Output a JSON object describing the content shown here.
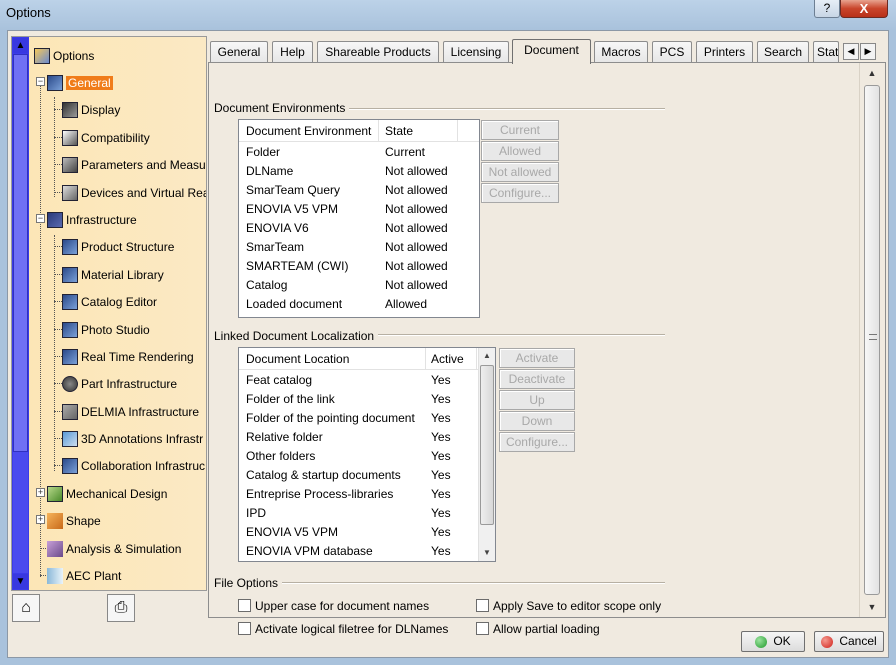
{
  "window": {
    "title": "Options",
    "help_label": "?",
    "close_label": "X"
  },
  "tree": {
    "items": [
      {
        "label": "Options",
        "icon": "options-tree-icon"
      },
      {
        "label": "General",
        "icon": "general-icon",
        "selected": true
      },
      {
        "label": "Display",
        "icon": "display-icon"
      },
      {
        "label": "Compatibility",
        "icon": "compatibility-icon"
      },
      {
        "label": "Parameters and Measure",
        "icon": "parameters-icon"
      },
      {
        "label": "Devices and Virtual Real",
        "icon": "devices-icon"
      },
      {
        "label": "Infrastructure",
        "icon": "infrastructure-icon"
      },
      {
        "label": "Product Structure",
        "icon": "product-structure-icon"
      },
      {
        "label": "Material Library",
        "icon": "material-library-icon"
      },
      {
        "label": "Catalog Editor",
        "icon": "catalog-editor-icon"
      },
      {
        "label": "Photo Studio",
        "icon": "photo-studio-icon"
      },
      {
        "label": "Real Time Rendering",
        "icon": "rendering-icon"
      },
      {
        "label": "Part Infrastructure",
        "icon": "part-infrastructure-icon"
      },
      {
        "label": "DELMIA Infrastructure",
        "icon": "delmia-icon"
      },
      {
        "label": "3D Annotations Infrastr",
        "icon": "annotations-icon"
      },
      {
        "label": "Collaboration Infrastruc",
        "icon": "collaboration-icon"
      },
      {
        "label": "Mechanical Design",
        "icon": "mechanical-design-icon"
      },
      {
        "label": "Shape",
        "icon": "shape-icon"
      },
      {
        "label": "Analysis & Simulation",
        "icon": "analysis-icon"
      },
      {
        "label": "AEC Plant",
        "icon": "aec-plant-icon"
      }
    ]
  },
  "tabs": [
    "General",
    "Help",
    "Shareable Products",
    "Licensing",
    "Document",
    "Macros",
    "PCS",
    "Printers",
    "Search",
    "Stat"
  ],
  "active_tab": "Document",
  "doc_env": {
    "title": "Document Environments",
    "headers": [
      "Document Environment",
      "State"
    ],
    "rows": [
      [
        "Folder",
        "Current"
      ],
      [
        "DLName",
        "Not allowed"
      ],
      [
        "SmarTeam Query",
        "Not allowed"
      ],
      [
        "ENOVIA V5 VPM",
        "Not allowed"
      ],
      [
        "ENOVIA V6",
        "Not allowed"
      ],
      [
        "SmarTeam",
        "Not allowed"
      ],
      [
        "SMARTEAM (CWI)",
        "Not allowed"
      ],
      [
        "Catalog",
        "Not allowed"
      ],
      [
        "Loaded document",
        "Allowed"
      ]
    ],
    "buttons": [
      "Current",
      "Allowed",
      "Not allowed",
      "Configure..."
    ]
  },
  "linked": {
    "title": "Linked Document Localization",
    "headers": [
      "Document Location",
      "Active"
    ],
    "rows": [
      [
        "Feat catalog",
        "Yes"
      ],
      [
        "Folder of the link",
        "Yes"
      ],
      [
        "Folder of the pointing document",
        "Yes"
      ],
      [
        "Relative folder",
        "Yes"
      ],
      [
        "Other folders",
        "Yes"
      ],
      [
        "Catalog & startup documents",
        "Yes"
      ],
      [
        "Entreprise Process-libraries",
        "Yes"
      ],
      [
        "IPD",
        "Yes"
      ],
      [
        "ENOVIA V5 VPM",
        "Yes"
      ],
      [
        "ENOVIA VPM  database",
        "Yes"
      ]
    ],
    "buttons": [
      "Activate",
      "Deactivate",
      "Up",
      "Down",
      "Configure..."
    ]
  },
  "file_options": {
    "title": "File Options",
    "checks": [
      {
        "label": "Upper case for document names",
        "checked": false
      },
      {
        "label": "Apply Save to editor scope only",
        "checked": false
      },
      {
        "label": "Activate logical filetree for DLNames",
        "checked": false
      },
      {
        "label": "Allow partial loading",
        "checked": false
      }
    ]
  },
  "footer": {
    "ok_label": "OK",
    "cancel_label": "Cancel",
    "ok_color": "#1f9a2b",
    "cancel_color": "#d0201a"
  },
  "colors": {
    "selection": "#f07c1a",
    "tree_bg": "#fce6b5",
    "tree_scroll": "#3b3be8"
  }
}
